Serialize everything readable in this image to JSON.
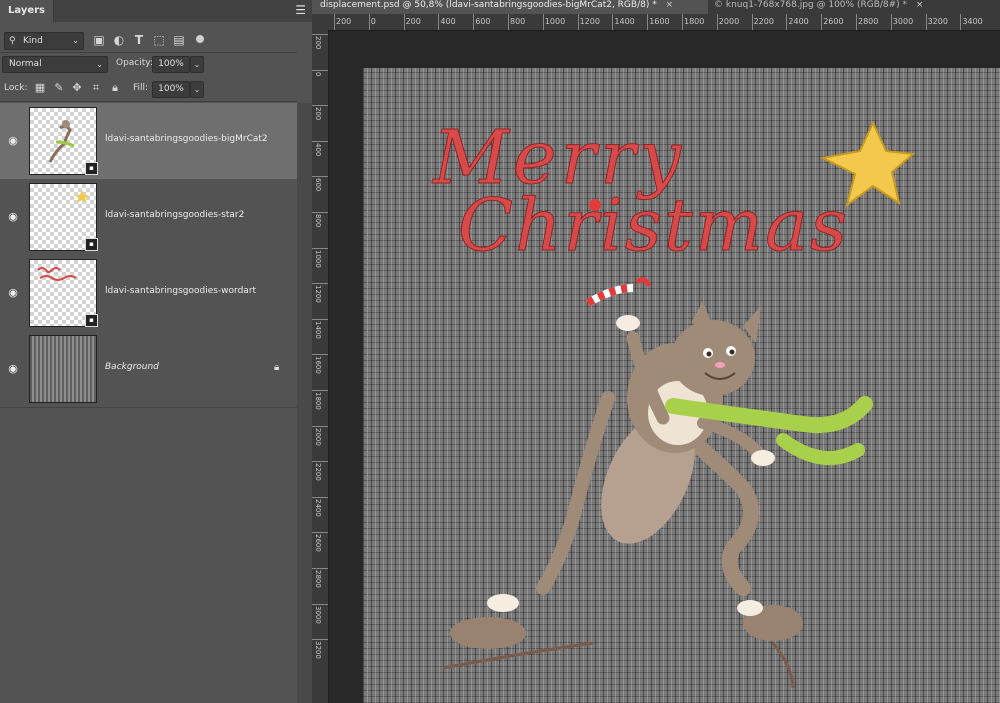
{
  "layers_panel": {
    "title": "Layers",
    "filter_kind": "Kind",
    "blend_mode": "Normal",
    "opacity_label": "Opacity:",
    "opacity_value": "100%",
    "lock_label": "Lock:",
    "fill_label": "Fill:",
    "fill_value": "100%",
    "layers": [
      {
        "name": "ldavi-santabringsgoodies-bigMrCat2",
        "selected": true
      },
      {
        "name": "ldavi-santabringsgoodies-star2",
        "selected": false
      },
      {
        "name": "ldavi-santabringsgoodies-wordart",
        "selected": false
      },
      {
        "name": "Background",
        "selected": false
      }
    ]
  },
  "document_tabs": [
    {
      "label": "displacement.psd @ 50,8% (ldavi-santabringsgoodies-bigMrCat2, RGB/8) *",
      "close": "×",
      "active": true
    },
    {
      "label": "© knuq1-768x768.jpg @ 100% (RGB/8#) *",
      "close": "×",
      "active": false
    }
  ],
  "ruler_h": [
    "200",
    "0",
    "200",
    "400",
    "600",
    "800",
    "1000",
    "1200",
    "1400",
    "1600",
    "1800",
    "2000",
    "2200",
    "2400",
    "2600",
    "2800",
    "3000",
    "3200",
    "3400"
  ],
  "ruler_v": [
    "200",
    "0",
    "200",
    "400",
    "600",
    "800",
    "1000",
    "1200",
    "1400",
    "1600",
    "1800",
    "2000",
    "2200",
    "2400",
    "2600",
    "2800",
    "3000",
    "3200"
  ],
  "artwork": {
    "wordart_line1": "Merry",
    "wordart_line2": "Christmas",
    "wordart_color": "#d84a4a",
    "star_color": "#f2c94c",
    "scarf_color": "#a8d04a",
    "cat_color": "#a08a78"
  }
}
